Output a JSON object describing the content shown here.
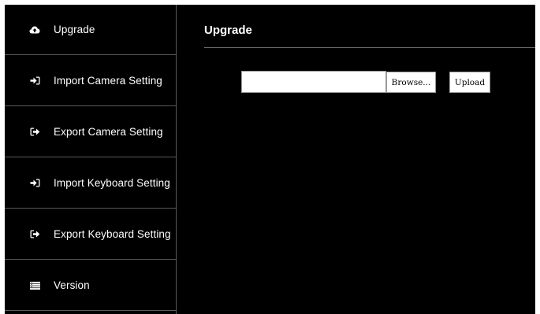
{
  "sidebar": {
    "items": [
      {
        "label": "Upgrade",
        "icon": "cloud-upload-icon"
      },
      {
        "label": "Import Camera Setting",
        "icon": "sign-in-icon"
      },
      {
        "label": "Export Camera Setting",
        "icon": "sign-out-icon"
      },
      {
        "label": "Import Keyboard Setting",
        "icon": "sign-in-icon"
      },
      {
        "label": "Export Keyboard Setting",
        "icon": "sign-out-icon"
      },
      {
        "label": "Version",
        "icon": "list-icon"
      }
    ]
  },
  "main": {
    "title": "Upgrade",
    "file_input": {
      "value": ""
    },
    "browse_label": "Browse...",
    "upload_label": "Upload"
  },
  "colors": {
    "background": "#000000",
    "text": "#ffffff",
    "divider": "#5a5a5a",
    "input_bg": "#ffffff"
  }
}
